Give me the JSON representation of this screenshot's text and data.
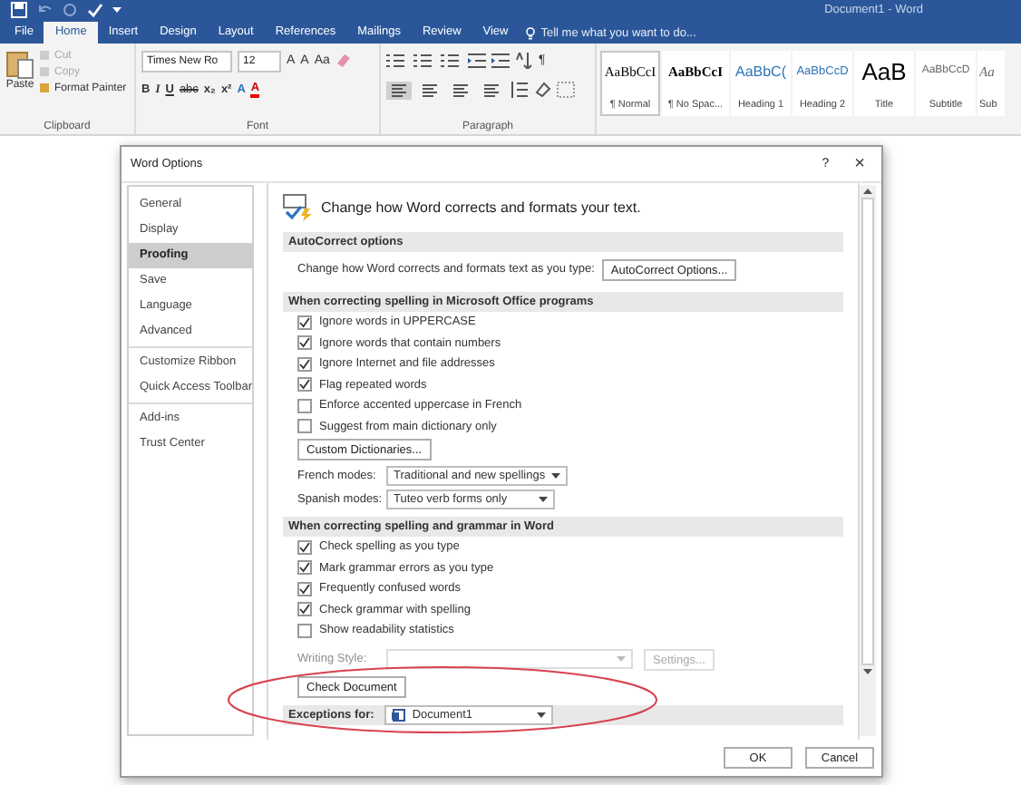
{
  "window": {
    "title": "Document1 - Word"
  },
  "ribbon_tabs": [
    {
      "label": "File",
      "selected": false
    },
    {
      "label": "Home",
      "selected": true
    },
    {
      "label": "Insert",
      "selected": false
    },
    {
      "label": "Design",
      "selected": false
    },
    {
      "label": "Layout",
      "selected": false
    },
    {
      "label": "References",
      "selected": false
    },
    {
      "label": "Mailings",
      "selected": false
    },
    {
      "label": "Review",
      "selected": false
    },
    {
      "label": "View",
      "selected": false
    }
  ],
  "tell_me": {
    "placeholder": "Tell me what you want to do..."
  },
  "clipboard": {
    "group": "Clipboard",
    "paste": "Paste",
    "items": [
      {
        "label": "Cut",
        "disabled": true
      },
      {
        "label": "Copy",
        "disabled": true
      },
      {
        "label": "Format Painter",
        "disabled": false
      }
    ]
  },
  "font": {
    "group": "Font",
    "name": "Times New Ro",
    "size": "12",
    "row1": [
      "A",
      "A",
      "Aa"
    ],
    "row2": [
      "B",
      "I",
      "U",
      "abc",
      "x₂",
      "x²",
      "A",
      "A"
    ]
  },
  "paragraph": {
    "group": "Paragraph",
    "pilcrow": "¶",
    "alignments": [
      {
        "selected": true
      },
      {
        "selected": false
      },
      {
        "selected": false
      },
      {
        "selected": false
      }
    ]
  },
  "styles": [
    {
      "kind": "normal",
      "preview": "AaBbCcI",
      "name": "¶ Normal",
      "selected": true
    },
    {
      "kind": "nospacing",
      "preview": "AaBbCcI",
      "name": "¶ No Spac...",
      "selected": false
    },
    {
      "kind": "heading1",
      "preview": "AaBbC(",
      "name": "Heading 1",
      "selected": false
    },
    {
      "kind": "heading2",
      "preview": "AaBbCcD",
      "name": "Heading 2",
      "selected": false
    },
    {
      "kind": "title",
      "preview": "AaB",
      "name": "Title",
      "selected": false
    },
    {
      "kind": "subtitle",
      "preview": "AaBbCcD",
      "name": "Subtitle",
      "selected": false
    },
    {
      "kind": "cut",
      "preview": "Aa",
      "name": "Sub",
      "selected": false
    }
  ],
  "dialog": {
    "title": "Word Options",
    "help": "?",
    "close": "×",
    "nav_groups": [
      [
        {
          "label": "General",
          "selected": false
        },
        {
          "label": "Display",
          "selected": false
        },
        {
          "label": "Proofing",
          "selected": true
        },
        {
          "label": "Save",
          "selected": false
        },
        {
          "label": "Language",
          "selected": false
        },
        {
          "label": "Advanced",
          "selected": false
        }
      ],
      [
        {
          "label": "Customize Ribbon",
          "selected": false
        },
        {
          "label": "Quick Access Toolbar",
          "selected": false
        }
      ],
      [
        {
          "label": "Add-ins",
          "selected": false
        },
        {
          "label": "Trust Center",
          "selected": false
        }
      ]
    ],
    "header": "Change how Word corrects and formats your text.",
    "sections": [
      {
        "heading": "AutoCorrect options",
        "rows": [
          {
            "kind": "label_button",
            "label": "Change how Word corrects and formats text as you type:",
            "button": "AutoCorrect Options..."
          }
        ]
      },
      {
        "heading": "When correcting spelling in Microsoft Office programs",
        "rows": [
          {
            "kind": "checkbox",
            "label": "Ignore words in UPPERCASE",
            "checked": true
          },
          {
            "kind": "checkbox",
            "label": "Ignore words that contain numbers",
            "checked": true
          },
          {
            "kind": "checkbox",
            "label": "Ignore Internet and file addresses",
            "checked": true
          },
          {
            "kind": "checkbox",
            "label": "Flag repeated words",
            "checked": true
          },
          {
            "kind": "checkbox",
            "label": "Enforce accented uppercase in French",
            "checked": false
          },
          {
            "kind": "checkbox",
            "label": "Suggest from main dictionary only",
            "checked": false
          },
          {
            "kind": "button",
            "button": "Custom Dictionaries...",
            "disabled": false
          },
          {
            "kind": "select",
            "label": "French modes:",
            "value": "Traditional and new spellings"
          },
          {
            "kind": "select",
            "label": "Spanish modes:",
            "value": "Tuteo verb forms only"
          }
        ]
      },
      {
        "heading": "When correcting spelling and grammar in Word",
        "rows": [
          {
            "kind": "checkbox",
            "label": "Check spelling as you type",
            "checked": true
          },
          {
            "kind": "checkbox",
            "label": "Mark grammar errors as you type",
            "checked": true
          },
          {
            "kind": "checkbox",
            "label": "Frequently confused words",
            "checked": true
          },
          {
            "kind": "checkbox",
            "label": "Check grammar with spelling",
            "checked": true
          },
          {
            "kind": "checkbox",
            "label": "Show readability statistics",
            "checked": false
          },
          {
            "kind": "select_button",
            "label": "Writing Style:",
            "button": "Settings...",
            "disabled": true
          },
          {
            "kind": "button",
            "button": "Check Document",
            "disabled": false
          }
        ]
      },
      {
        "heading": "Exceptions for:",
        "kind": "exceptions",
        "value": "Document1"
      }
    ],
    "buttons": [
      "OK",
      "Cancel"
    ]
  }
}
